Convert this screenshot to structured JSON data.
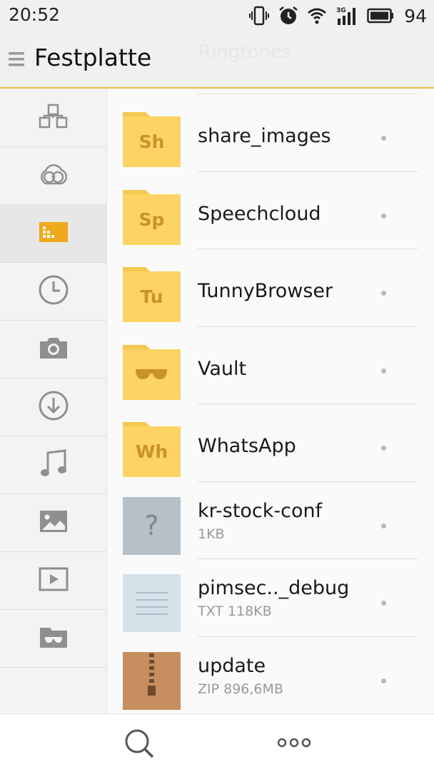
{
  "status_bar": {
    "time": "20:52",
    "battery": "94",
    "icons": [
      "vibrate-icon",
      "alarm-icon",
      "wifi-icon",
      "signal-3g-icon",
      "battery-icon"
    ]
  },
  "header": {
    "title": "Festplatte",
    "ghost_text": "Ringtones"
  },
  "sidebar": {
    "items": [
      {
        "icon": "categories-icon"
      },
      {
        "icon": "cloud-icon"
      },
      {
        "icon": "sd-card-icon",
        "active": true
      },
      {
        "icon": "recent-clock-icon"
      },
      {
        "icon": "camera-icon"
      },
      {
        "icon": "download-icon"
      },
      {
        "icon": "music-note-icon"
      },
      {
        "icon": "image-icon"
      },
      {
        "icon": "video-icon"
      },
      {
        "icon": "vault-folder-icon"
      }
    ]
  },
  "files": [
    {
      "name": "share_images",
      "type": "folder",
      "badge": "Sh"
    },
    {
      "name": "Speechcloud",
      "type": "folder",
      "badge": "Sp"
    },
    {
      "name": "TunnyBrowser",
      "type": "folder",
      "badge": "Tu"
    },
    {
      "name": "Vault",
      "type": "folder-vault",
      "badge": ""
    },
    {
      "name": "WhatsApp",
      "type": "folder",
      "badge": "Wh"
    },
    {
      "name": "kr-stock-conf",
      "type": "unknown",
      "meta": "1KB",
      "thumb_glyph": "?"
    },
    {
      "name": "pimsec.._debug",
      "type": "txt",
      "meta": "TXT 118KB"
    },
    {
      "name": "update",
      "type": "zip",
      "meta": "ZIP 896,6MB"
    }
  ],
  "colors": {
    "accent": "#e8b849",
    "folder": "#fdd464",
    "folder_tab": "#f5c84f",
    "folder_text": "#c9932a",
    "sidebar_active_icon": "#f0a81c"
  }
}
